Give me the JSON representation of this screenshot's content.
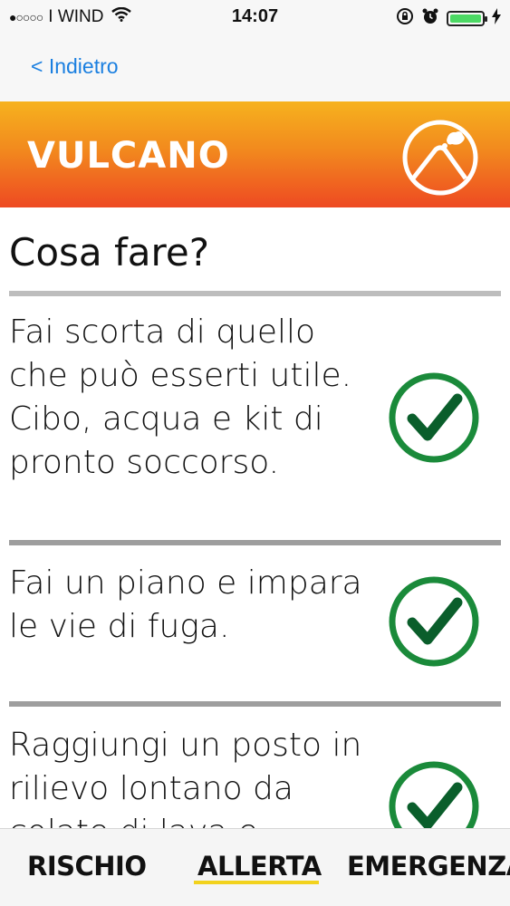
{
  "status_bar": {
    "carrier": "I WIND",
    "time": "14:07"
  },
  "nav": {
    "back_label": "< Indietro"
  },
  "header": {
    "title": "VULCANO"
  },
  "main": {
    "section_title": "Cosa fare?",
    "items": [
      {
        "text": "Fai scorta di quello che può esserti utile. Cibo, acqua e kit di pronto soccorso.",
        "checked": true
      },
      {
        "text": "Fai un piano e impara le vie di fuga.",
        "checked": true
      },
      {
        "text": "Raggiungi un posto in rilievo lontano da colate di lava e",
        "checked": true
      }
    ]
  },
  "tabs": [
    {
      "label": "RISCHIO",
      "active": false
    },
    {
      "label": "ALLERTA",
      "active": true
    },
    {
      "label": "EMERGENZA",
      "active": false
    }
  ],
  "colors": {
    "accent_blue": "#1a7fe0",
    "header_top": "#f6b21e",
    "header_bottom": "#ee4a22",
    "check_green": "#1a8a3a",
    "tab_active_underline": "#f2d21d"
  }
}
